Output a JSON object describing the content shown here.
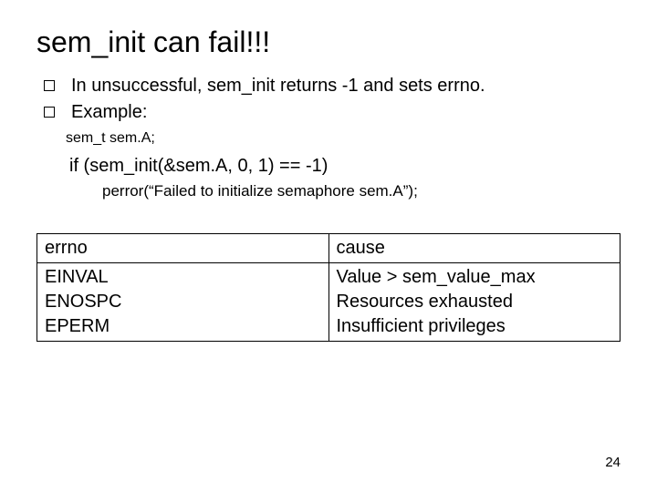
{
  "title": "sem_init can fail!!!",
  "bullets": [
    "In unsuccessful, sem_init returns -1 and sets errno.",
    "Example:"
  ],
  "decl": "sem_t sem.A;",
  "code_if": "if (sem_init(&sem.A, 0, 1) == -1)",
  "code_perror": "perror(“Failed to initialize semaphore sem.A”);",
  "table": {
    "header": {
      "c1": "errno",
      "c2": "cause"
    },
    "rows": [
      {
        "c1": "EINVAL",
        "c2": "Value > sem_value_max"
      },
      {
        "c1": "ENOSPC",
        "c2": "Resources exhausted"
      },
      {
        "c1": "EPERM",
        "c2": "Insufficient privileges"
      }
    ]
  },
  "page_number": "24"
}
